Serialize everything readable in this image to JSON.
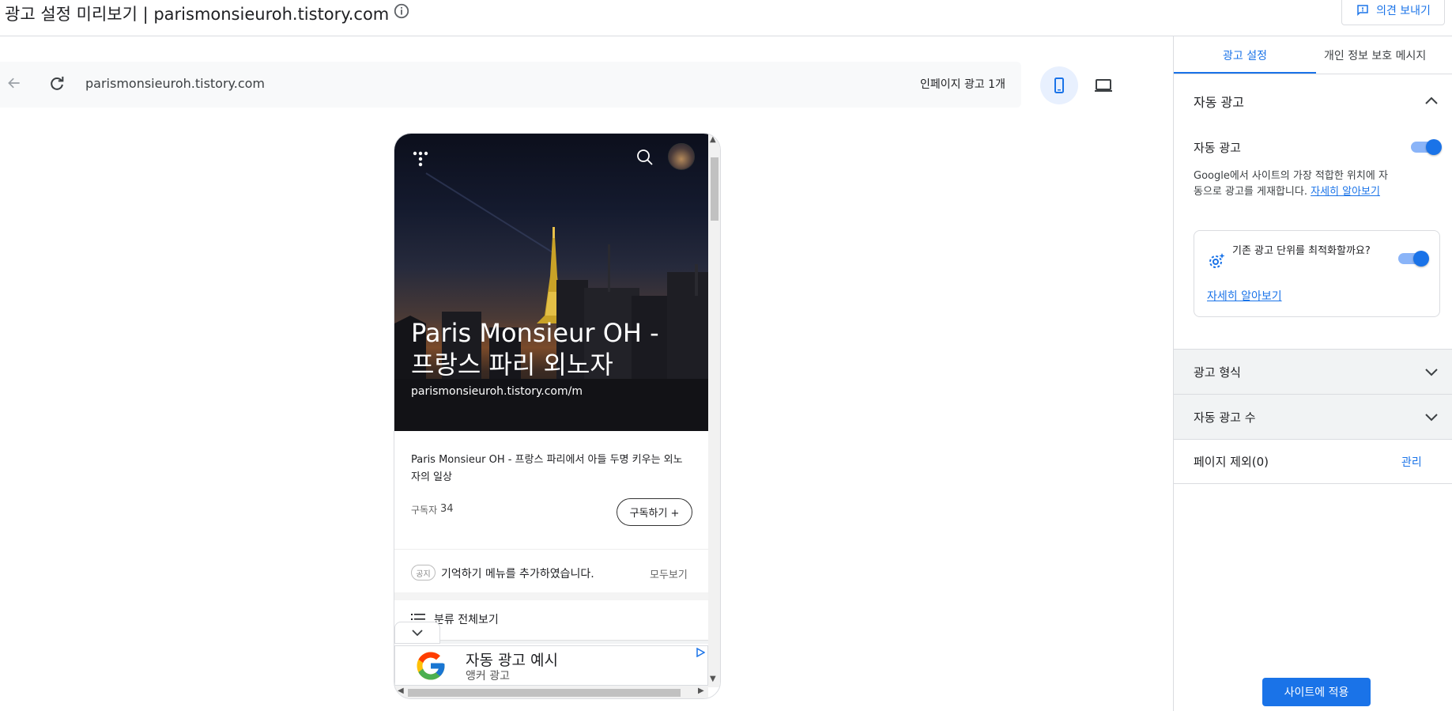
{
  "header": {
    "title": "광고 설정 미리보기 | parismonsieuroh.tistory.com",
    "feedback_label": "의견 보내기"
  },
  "preview": {
    "url": "parismonsieuroh.tistory.com",
    "ad_count": "인페이지 광고 1개"
  },
  "blog": {
    "hero_title": "Paris Monsieur OH - 프랑스 파리 외노자",
    "hero_url": "parismonsieuroh.tistory.com/m",
    "description": "Paris Monsieur OH - 프랑스 파리에서 아들 두명 키우는 외노자의 일상",
    "subscribers_label": "구독자",
    "subscribers_count": "34",
    "subscribe_label": "구독하기 +",
    "notice_badge": "공지",
    "notice_text": "기억하기 메뉴를 추가하였습니다.",
    "notice_more": "모두보기",
    "category_label": "분류 전체보기"
  },
  "ad_example": {
    "title": "자동 광고 예시",
    "subtitle": "앵커 광고"
  },
  "panel": {
    "tabs": [
      "광고 설정",
      "개인 정보 보호 메시지"
    ],
    "auto_ads_section": "자동 광고",
    "auto_ads_label": "자동 광고",
    "auto_ads_enabled": true,
    "auto_ads_desc": "Google에서 사이트의 가장 적합한 위치에 자동으로 광고를 게재합니다.",
    "learn_more": "자세히 알아보기",
    "optimize_text": "기존 광고 단위를 최적화할까요?",
    "optimize_enabled": true,
    "optimize_link": "자세히 알아보기",
    "ad_format": "광고 형식",
    "ad_load": "자동 광고 수",
    "page_exclusion": "페이지 제외(0)",
    "manage": "관리",
    "apply": "사이트에 적용"
  },
  "colors": {
    "accent": "#1a73e8",
    "toggle_track": "#8ab4f8"
  }
}
